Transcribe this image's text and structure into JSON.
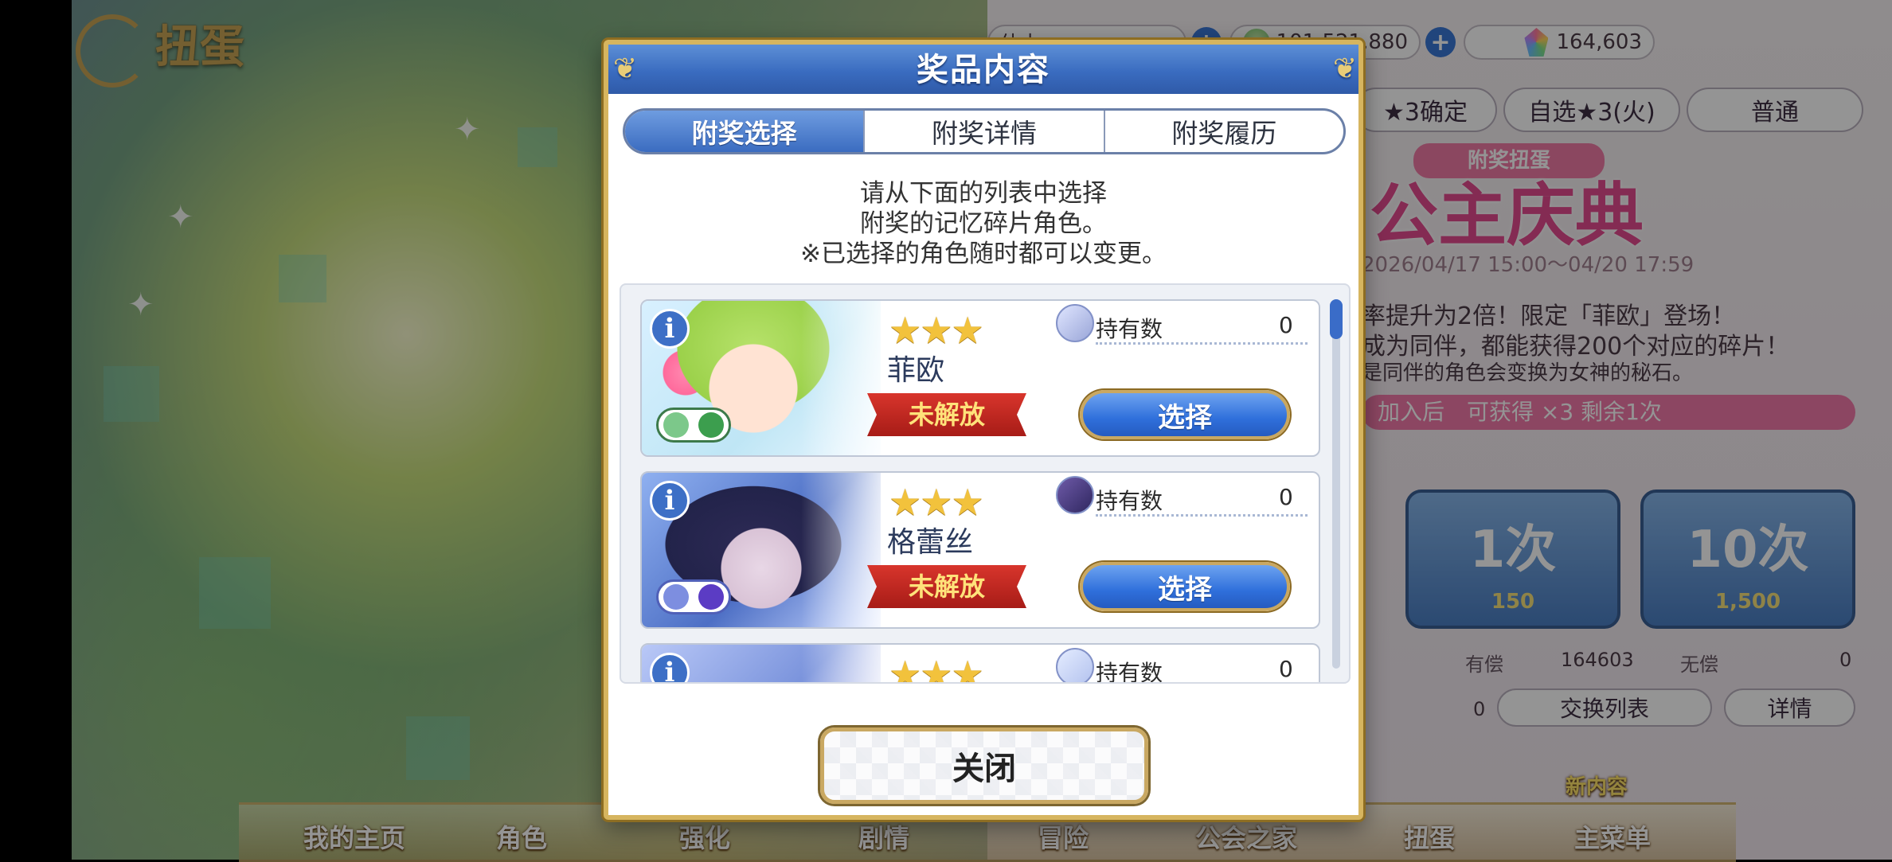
{
  "background": {
    "title": "扭蛋",
    "hud": {
      "stamina_label": "体力",
      "mana": "101,521,880",
      "jewels": "164,603"
    },
    "gacha_tabs": [
      "★3确定",
      "自选★3(火)",
      "普通"
    ],
    "banner": {
      "subtitle": "附奖扭蛋",
      "title": "公主庆典",
      "date": "2026/04/17 15:00～04/20 17:59",
      "line1": "率提升为2倍！限定「菲欧」登场！",
      "line2": "成为同伴，都能获得200个对应的碎片！",
      "line3": "是同伴的角色会变换为女神的秘石。",
      "pink_bar": "加入后　可获得 ×3 剩余1次"
    },
    "pull_buttons": [
      {
        "label": "1次",
        "cost": "150"
      },
      {
        "label": "10次",
        "cost": "1,500"
      }
    ],
    "counters": {
      "paid_label": "有偿",
      "paid_value": "164603",
      "free_label": "无偿",
      "free_value": "0",
      "left_value": "0"
    },
    "buttons": {
      "exchange": "交换列表",
      "details": "详情"
    },
    "bottom_nav": [
      "我的主页",
      "角色",
      "强化",
      "剧情",
      "冒险",
      "公会之家",
      "扭蛋",
      "主菜单"
    ],
    "new_content": "新内容"
  },
  "modal": {
    "title": "奖品内容",
    "tabs": [
      "附奖选择",
      "附奖详情",
      "附奖履历"
    ],
    "active_tab": 0,
    "instructions": [
      "请从下面的列表中选择",
      "附奖的记忆碎片角色。",
      "※已选择的角色随时都可以变更。"
    ],
    "characters": [
      {
        "name": "菲欧",
        "stars": "★★★",
        "status": "未解放",
        "owned_label": "持有数",
        "owned_count": "0",
        "select_label": "选择",
        "portrait": "green-hair-girl"
      },
      {
        "name": "格蕾丝",
        "stars": "★★★",
        "status": "未解放",
        "owned_label": "持有数",
        "owned_count": "0",
        "select_label": "选择",
        "portrait": "dark-hair-girl"
      },
      {
        "name": "",
        "stars": "★★★",
        "status": "",
        "owned_label": "持有数",
        "owned_count": "0",
        "select_label": "",
        "portrait": "blue-hair-girl"
      }
    ],
    "scroll_position": 0,
    "close_label": "关闭"
  },
  "colors": {
    "header_blue": "#3a6cc0",
    "gold_border": "#d6b55f",
    "select_blue": "#2f6fdb",
    "locked_red": "#c12a23"
  }
}
